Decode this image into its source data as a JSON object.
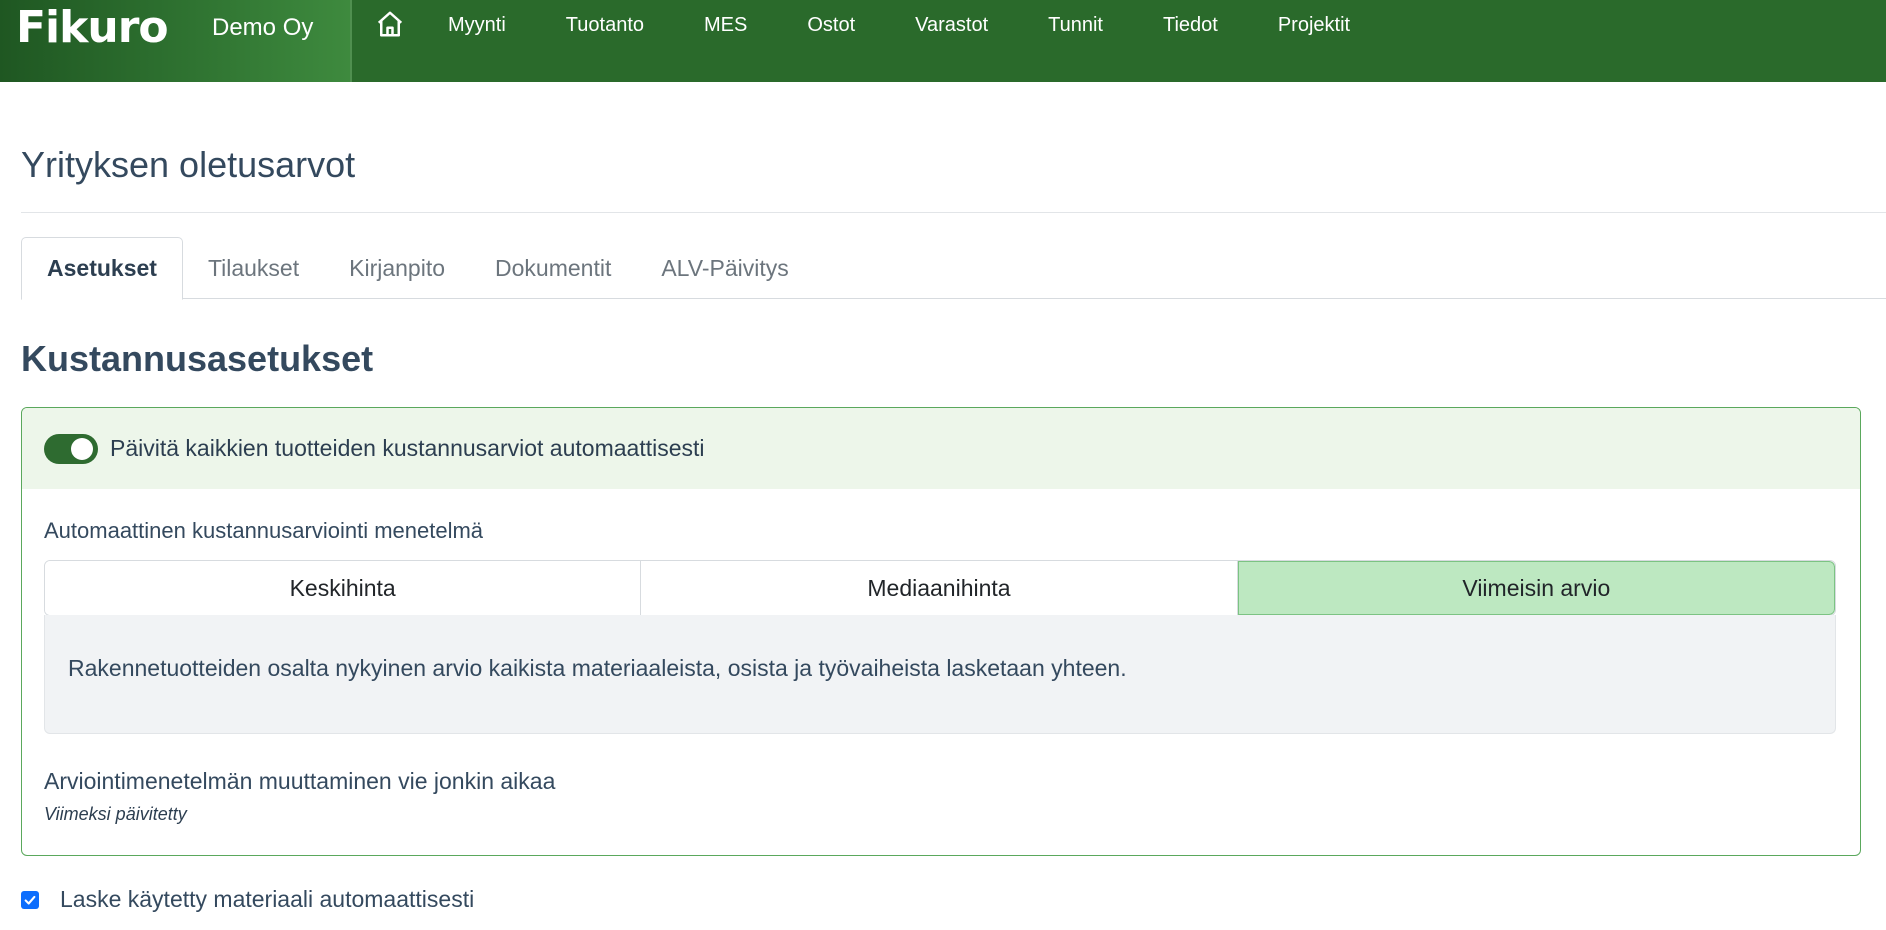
{
  "navbar": {
    "logo": "Fikuro",
    "company": "Demo Oy",
    "home_icon": "home-icon",
    "items": [
      {
        "label": "Myynti"
      },
      {
        "label": "Tuotanto"
      },
      {
        "label": "MES"
      },
      {
        "label": "Ostot"
      },
      {
        "label": "Varastot"
      },
      {
        "label": "Tunnit"
      },
      {
        "label": "Tiedot"
      },
      {
        "label": "Projektit"
      }
    ]
  },
  "page": {
    "title": "Yrityksen oletusarvot"
  },
  "tabs": [
    {
      "label": "Asetukset",
      "active": true
    },
    {
      "label": "Tilaukset"
    },
    {
      "label": "Kirjanpito"
    },
    {
      "label": "Dokumentit"
    },
    {
      "label": "ALV-Päivitys"
    }
  ],
  "cost_settings": {
    "title": "Kustannusasetukset",
    "auto_update_toggle": {
      "label": "Päivitä kaikkien tuotteiden kustannusarviot automaattisesti",
      "on": true
    },
    "method_label": "Automaattinen kustannusarviointi menetelmä",
    "methods": [
      {
        "label": "Keskihinta"
      },
      {
        "label": "Mediaanihinta"
      },
      {
        "label": "Viimeisin arvio",
        "selected": true
      }
    ],
    "method_description": "Rakennetuotteiden osalta nykyinen arvio kaikista materiaaleista, osista ja työvaiheista lasketaan yhteen.",
    "change_note": "Arviointimenetelmän muuttaminen vie jonkin aikaa",
    "last_updated_label": "Viimeksi päivitetty"
  },
  "material_checkbox": {
    "label": "Laske käytetty materiaali automaattisesti",
    "checked": true
  },
  "colors": {
    "navbar": "#2a6a2b",
    "accent_green": "#2e6b30",
    "selected_segment": "#bde8c1",
    "checkbox": "#0d6efd"
  }
}
